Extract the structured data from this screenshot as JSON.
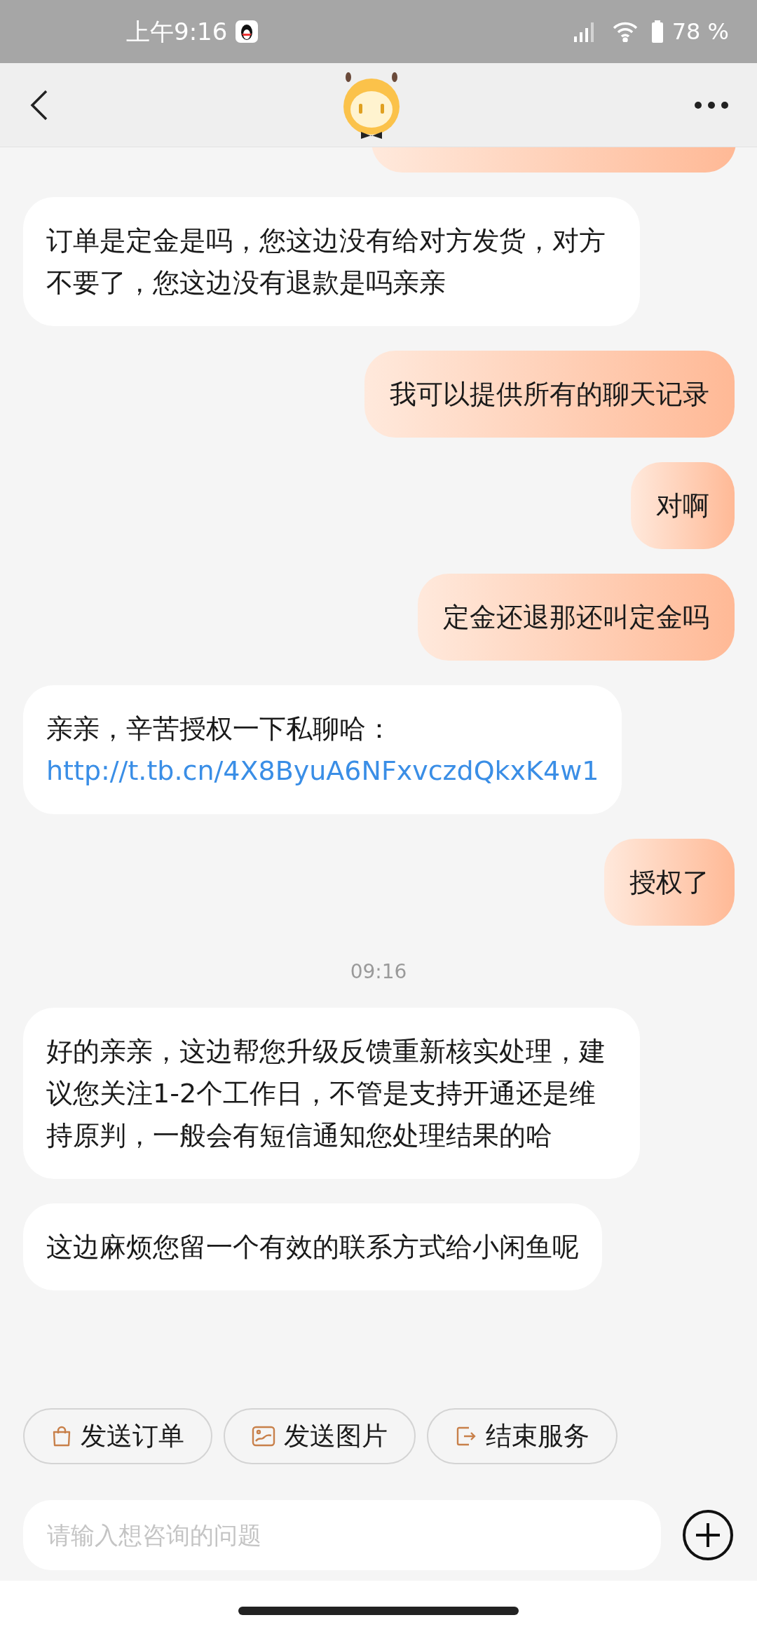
{
  "status_bar": {
    "time": "上午9:16",
    "battery": "78 %"
  },
  "messages": [
    {
      "kind": "cut"
    },
    {
      "kind": "received",
      "text": "订单是定金是吗，您这边没有给对方发货，对方不要了，您这边没有退款是吗亲亲"
    },
    {
      "kind": "sent",
      "text": "我可以提供所有的聊天记录"
    },
    {
      "kind": "sent",
      "text": "对啊"
    },
    {
      "kind": "sent",
      "text": "定金还退那还叫定金吗"
    },
    {
      "kind": "received",
      "text": "亲亲，辛苦授权一下私聊哈：",
      "link": "http://t.tb.cn/4X8ByuA6NFxvczdQkxK4w1"
    },
    {
      "kind": "sent",
      "text": "授权了"
    },
    {
      "kind": "time",
      "text": "09:16"
    },
    {
      "kind": "received",
      "text": "好的亲亲，这边帮您升级反馈重新核实处理，建议您关注1-2个工作日，不管是支持开通还是维持原判，一般会有短信通知您处理结果的哈"
    },
    {
      "kind": "received",
      "text": "这边麻烦您留一个有效的联系方式给小闲鱼呢"
    }
  ],
  "quick_actions": [
    {
      "label": "发送订单"
    },
    {
      "label": "发送图片"
    },
    {
      "label": "结束服务"
    }
  ],
  "input": {
    "placeholder": "请输入想咨询的问题"
  }
}
